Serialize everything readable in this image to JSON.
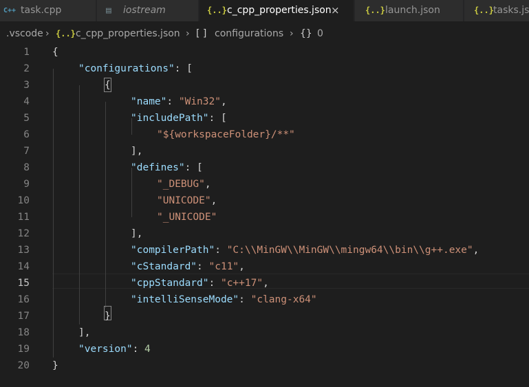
{
  "tabs": [
    {
      "icon": "C++",
      "label": "task.cpp"
    },
    {
      "icon": "▤",
      "label": "iostream"
    },
    {
      "icon": "{..}",
      "label": "c_cpp_properties.json",
      "close": "×"
    },
    {
      "icon": "{..}",
      "label": "launch.json"
    },
    {
      "icon": "{..}",
      "label": "tasks.json"
    }
  ],
  "breadcrumb": {
    "folder": ".vscode",
    "file_icon": "{..}",
    "file": "c_cpp_properties.json",
    "array_icon": "[ ]",
    "array": "configurations",
    "obj_icon": "{}",
    "obj": "0"
  },
  "colors": {
    "key": "#9cdcfe",
    "string": "#ce9178",
    "number": "#b5cea8",
    "json_icon": "#cbcb41",
    "cpp_icon": "#519aba"
  },
  "code_lines": [
    {
      "n": "1",
      "ind": 0,
      "parts": [
        [
          "p",
          "{"
        ]
      ]
    },
    {
      "n": "2",
      "ind": 1,
      "parts": [
        [
          "k",
          "\"configurations\""
        ],
        [
          "p",
          ": ["
        ]
      ]
    },
    {
      "n": "3",
      "ind": 2,
      "parts": [
        [
          "p",
          "{"
        ]
      ]
    },
    {
      "n": "4",
      "ind": 3,
      "parts": [
        [
          "k",
          "\"name\""
        ],
        [
          "p",
          ": "
        ],
        [
          "s",
          "\"Win32\""
        ],
        [
          "p",
          ","
        ]
      ]
    },
    {
      "n": "5",
      "ind": 3,
      "parts": [
        [
          "k",
          "\"includePath\""
        ],
        [
          "p",
          ": ["
        ]
      ]
    },
    {
      "n": "6",
      "ind": 4,
      "parts": [
        [
          "s",
          "\"${workspaceFolder}/**\""
        ]
      ]
    },
    {
      "n": "7",
      "ind": 3,
      "parts": [
        [
          "p",
          "],"
        ]
      ]
    },
    {
      "n": "8",
      "ind": 3,
      "parts": [
        [
          "k",
          "\"defines\""
        ],
        [
          "p",
          ": ["
        ]
      ]
    },
    {
      "n": "9",
      "ind": 4,
      "parts": [
        [
          "s",
          "\"_DEBUG\""
        ],
        [
          "p",
          ","
        ]
      ]
    },
    {
      "n": "10",
      "ind": 4,
      "parts": [
        [
          "s",
          "\"UNICODE\""
        ],
        [
          "p",
          ","
        ]
      ]
    },
    {
      "n": "11",
      "ind": 4,
      "parts": [
        [
          "s",
          "\"_UNICODE\""
        ]
      ]
    },
    {
      "n": "12",
      "ind": 3,
      "parts": [
        [
          "p",
          "],"
        ]
      ]
    },
    {
      "n": "13",
      "ind": 3,
      "parts": [
        [
          "k",
          "\"compilerPath\""
        ],
        [
          "p",
          ": "
        ],
        [
          "s",
          "\"C:\\\\MinGW\\\\MinGW\\\\mingw64\\\\bin\\\\g++.exe\""
        ],
        [
          "p",
          ","
        ]
      ]
    },
    {
      "n": "14",
      "ind": 3,
      "parts": [
        [
          "k",
          "\"cStandard\""
        ],
        [
          "p",
          ": "
        ],
        [
          "s",
          "\"c11\""
        ],
        [
          "p",
          ","
        ]
      ]
    },
    {
      "n": "15",
      "ind": 3,
      "parts": [
        [
          "k",
          "\"cppStandard\""
        ],
        [
          "p",
          ": "
        ],
        [
          "s",
          "\"c++17\""
        ],
        [
          "p",
          ","
        ]
      ]
    },
    {
      "n": "16",
      "ind": 3,
      "parts": [
        [
          "k",
          "\"intelliSenseMode\""
        ],
        [
          "p",
          ": "
        ],
        [
          "s",
          "\"clang-x64\""
        ]
      ]
    },
    {
      "n": "17",
      "ind": 2,
      "parts": [
        [
          "p",
          "}"
        ]
      ]
    },
    {
      "n": "18",
      "ind": 1,
      "parts": [
        [
          "p",
          "],"
        ]
      ]
    },
    {
      "n": "19",
      "ind": 1,
      "parts": [
        [
          "k",
          "\"version\""
        ],
        [
          "p",
          ": "
        ],
        [
          "n",
          "4"
        ]
      ]
    },
    {
      "n": "20",
      "ind": 0,
      "parts": [
        [
          "p",
          "}"
        ]
      ]
    }
  ]
}
